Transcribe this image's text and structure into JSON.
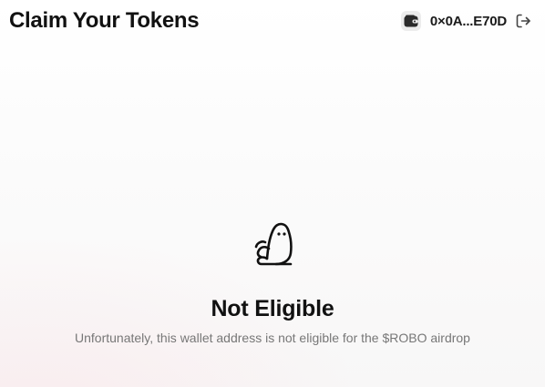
{
  "header": {
    "title": "Claim Your Tokens",
    "wallet": {
      "icon": "wallet-icon",
      "address": "0×0A...E70D"
    },
    "logout_icon": "logout-icon"
  },
  "status": {
    "icon": "ghost-icon",
    "title": "Not Eligible",
    "message": "Unfortunately, this wallet address is not eligible for the $ROBO airdrop"
  },
  "colors": {
    "text_primary": "#111111",
    "text_secondary": "#777777",
    "wallet_icon_bg": "#ececec",
    "background_tint": "#fae2e6"
  }
}
